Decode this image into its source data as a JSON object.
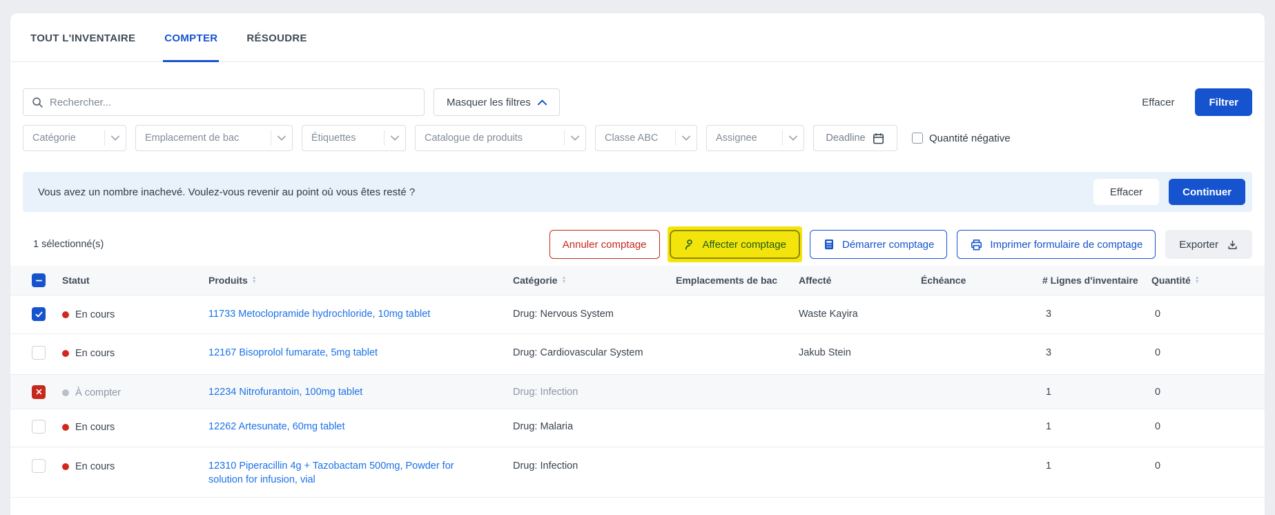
{
  "tabs": [
    {
      "label": "TOUT L'INVENTAIRE",
      "active": false
    },
    {
      "label": "COMPTER",
      "active": true
    },
    {
      "label": "RÉSOUDRE",
      "active": false
    }
  ],
  "filters": {
    "search_placeholder": "Rechercher...",
    "toggle_label": "Masquer les filtres",
    "clear_label": "Effacer",
    "apply_label": "Filtrer",
    "dropdowns": {
      "category": "Catégorie",
      "bin_location": "Emplacement de bac",
      "tags": "Étiquettes",
      "product_catalog": "Catalogue de produits",
      "abc_class": "Classe ABC",
      "assignee": "Assignee"
    },
    "deadline_label": "Deadline",
    "negative_quantity_label": "Quantité négative"
  },
  "banner": {
    "message": "Vous avez un nombre inachevé. Voulez-vous revenir au point où vous êtes resté ?",
    "clear_label": "Effacer",
    "continue_label": "Continuer"
  },
  "actions": {
    "selected_count": "1 sélectionné(s)",
    "cancel_count_label": "Annuler comptage",
    "assign_count_label": "Affecter comptage",
    "start_count_label": "Démarrer comptage",
    "print_form_label": "Imprimer formulaire de comptage",
    "export_label": "Exporter"
  },
  "table": {
    "headers": {
      "status": "Statut",
      "products": "Produits",
      "category": "Catégorie",
      "bin_locations": "Emplacements de bac",
      "assigned": "Affecté",
      "due": "Échéance",
      "inventory_lines": "# Lignes d'inventaire",
      "quantity": "Quantité"
    },
    "rows": [
      {
        "checkbox_state": "checked",
        "status": "En cours",
        "status_color": "red",
        "product": "11733 Metoclopramide hydrochloride, 10mg tablet",
        "category": "Drug: Nervous System",
        "bin_locations": "",
        "assigned": "Waste Kayira",
        "due": "",
        "inventory_lines": "3",
        "quantity": "0"
      },
      {
        "checkbox_state": "unchecked",
        "status": "En cours",
        "status_color": "red",
        "product": "12167 Bisoprolol fumarate, 5mg tablet",
        "category": "Drug: Cardiovascular System",
        "bin_locations": "",
        "assigned": "Jakub Stein",
        "due": "",
        "inventory_lines": "3",
        "quantity": "0"
      },
      {
        "checkbox_state": "excluded",
        "status": "À compter",
        "status_color": "gray",
        "product": "12234 Nitrofurantoin, 100mg tablet",
        "category": "Drug: Infection",
        "bin_locations": "",
        "assigned": "",
        "due": "",
        "inventory_lines": "1",
        "quantity": "0"
      },
      {
        "checkbox_state": "unchecked",
        "status": "En cours",
        "status_color": "red",
        "product": "12262 Artesunate, 60mg tablet",
        "category": "Drug: Malaria",
        "bin_locations": "",
        "assigned": "",
        "due": "",
        "inventory_lines": "1",
        "quantity": "0"
      },
      {
        "checkbox_state": "unchecked",
        "status": "En cours",
        "status_color": "red",
        "product": "12310 Piperacillin 4g + Tazobactam 500mg, Powder for solution for infusion, vial",
        "category": "Drug: Infection",
        "bin_locations": "",
        "assigned": "",
        "due": "",
        "inventory_lines": "1",
        "quantity": "0"
      }
    ]
  },
  "colors": {
    "accent_blue": "#1553cf",
    "link_blue": "#1b72e8",
    "danger_red": "#c5281c",
    "highlight_yellow": "#f3e50c",
    "banner_bg": "#e9f1fb",
    "status_red": "#d2271d",
    "status_gray": "#b9c0c8"
  }
}
